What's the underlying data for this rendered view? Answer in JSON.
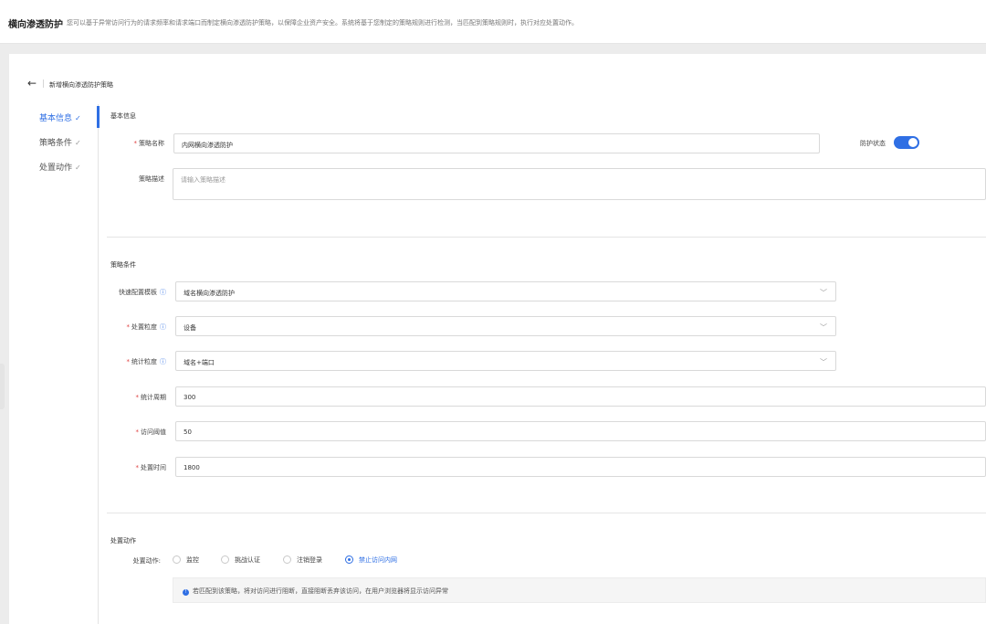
{
  "header": {
    "title": "横向渗透防护",
    "description": "您可以基于异常访问行为的请求频率和请求端口而制定横向渗透防护策略，以保障企业资产安全。系统将基于您制定的策略规则进行检测，当匹配到策略规则时，执行对应处置动作。"
  },
  "page": {
    "back_icon": "←",
    "title": "新增横向渗透防护策略"
  },
  "nav": {
    "items": [
      {
        "label": "基本信息",
        "check": "✓",
        "active": true
      },
      {
        "label": "策略条件",
        "check": "✓",
        "active": false
      },
      {
        "label": "处置动作",
        "check": "✓",
        "active": false
      }
    ]
  },
  "basic": {
    "section_title": "基本信息",
    "name_label": "策略名称",
    "name_value": "内网横向渗透防护",
    "status_label": "防护状态",
    "status_on": true,
    "desc_label": "策略描述",
    "desc_placeholder": "请输入策略描述"
  },
  "conditions": {
    "section_title": "策略条件",
    "template_label": "快速配置模板",
    "template_value": "域名横向渗透防护",
    "granularity_label": "处置粒度",
    "granularity_value": "设备",
    "stat_granularity_label": "统计粒度",
    "stat_granularity_value": "域名+端口",
    "period_label": "统计周期",
    "period_value": "300",
    "threshold_label": "访问阈值",
    "threshold_value": "50",
    "time_label": "处置时间",
    "time_value": "1800",
    "info_icon": "ⓘ",
    "arrow_icon": "﹀",
    "required_mark": "*"
  },
  "actions": {
    "section_title": "处置动作",
    "label": "处置动作:",
    "options": [
      "监控",
      "挑战认证",
      "注销登录",
      "禁止访问内网"
    ],
    "selected": "禁止访问内网",
    "notice": "若匹配到该策略，将对访问进行阻断，直接阻断丢弃该访问，在用户浏览器将显示访问异常",
    "notice_icon": "!"
  },
  "colors": {
    "accent": "#2f6fe4",
    "required": "#e04141"
  }
}
